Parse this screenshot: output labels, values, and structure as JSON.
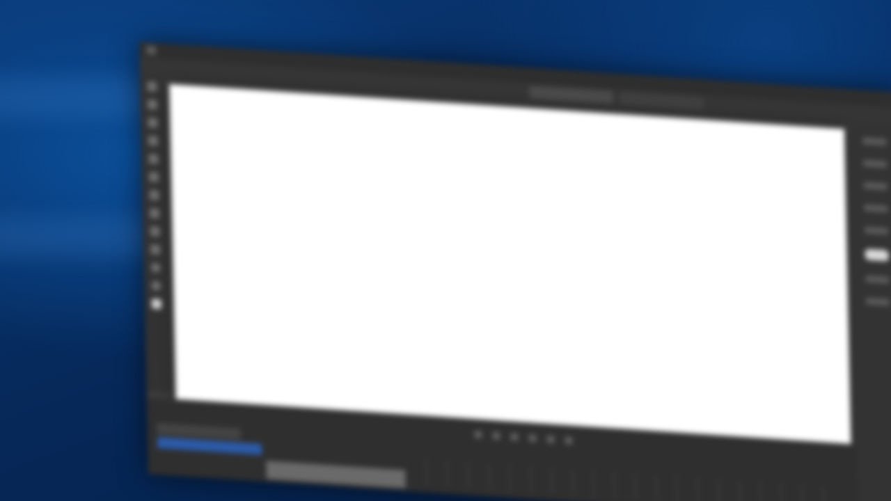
{
  "menubar": {
    "items": [
      "",
      "",
      "",
      "",
      "",
      "",
      "",
      "",
      "",
      "",
      ""
    ]
  },
  "tabs": [
    {
      "label": ""
    },
    {
      "label": ""
    }
  ],
  "colors": {
    "desktop_background": "#062a5c",
    "app_chrome": "#3a3a3a",
    "canvas": "#ffffff",
    "selection_accent": "#2c5aa8"
  },
  "tools": [
    "move-tool-icon",
    "marquee-tool-icon",
    "lasso-tool-icon",
    "crop-tool-icon",
    "eyedropper-tool-icon",
    "brush-tool-icon",
    "eraser-tool-icon",
    "gradient-tool-icon",
    "text-tool-icon",
    "pen-tool-icon",
    "hand-tool-icon",
    "zoom-tool-icon",
    "foreground-color-icon"
  ],
  "timeline": {
    "controls": [
      "first-frame-icon",
      "previous-frame-icon",
      "play-icon",
      "next-frame-icon",
      "audio-icon",
      "settings-icon"
    ]
  }
}
